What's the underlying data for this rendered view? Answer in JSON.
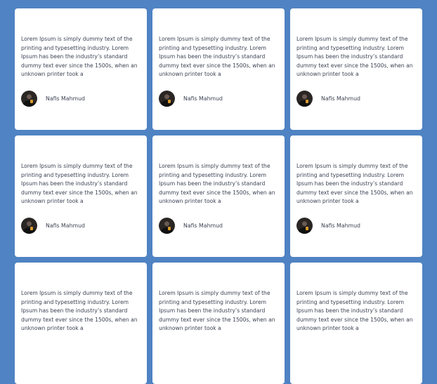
{
  "testimonials": [
    {
      "text": "Lorem Ipsum is simply dummy text of the printing and typesetting industry. Lorem Ipsum has been the industry’s standard dummy text ever since the 1500s, when an unknown printer took a",
      "author": "Nafis Mahmud"
    },
    {
      "text": "Lorem Ipsum is simply dummy text of the printing and typesetting industry. Lorem Ipsum has been the industry’s standard dummy text ever since the 1500s, when an unknown printer took a",
      "author": "Nafis Mahmud"
    },
    {
      "text": "Lorem Ipsum is simply dummy text of the printing and typesetting industry. Lorem Ipsum has been the industry’s standard dummy text ever since the 1500s, when an unknown printer took a",
      "author": "Nafis Mahmud"
    },
    {
      "text": "Lorem Ipsum is simply dummy text of the printing and typesetting industry. Lorem Ipsum has been the industry’s standard dummy text ever since the 1500s, when an unknown printer took a",
      "author": "Nafis Mahmud"
    },
    {
      "text": "Lorem Ipsum is simply dummy text of the printing and typesetting industry. Lorem Ipsum has been the industry’s standard dummy text ever since the 1500s, when an unknown printer took a",
      "author": "Nafis Mahmud"
    },
    {
      "text": "Lorem Ipsum is simply dummy text of the printing and typesetting industry. Lorem Ipsum has been the industry’s standard dummy text ever since the 1500s, when an unknown printer took a",
      "author": "Nafis Mahmud"
    },
    {
      "text": "Lorem Ipsum is simply dummy text of the printing and typesetting industry. Lorem Ipsum has been the industry’s standard dummy text ever since the 1500s, when an unknown printer took a",
      "author": ""
    },
    {
      "text": "Lorem Ipsum is simply dummy text of the printing and typesetting industry. Lorem Ipsum has been the industry’s standard dummy text ever since the 1500s, when an unknown printer took a",
      "author": ""
    },
    {
      "text": "Lorem Ipsum is simply dummy text of the printing and typesetting industry. Lorem Ipsum has been the industry’s standard dummy text ever since the 1500s, when an unknown printer took a",
      "author": ""
    }
  ],
  "colors": {
    "background": "#4f83c3",
    "card": "#ffffff",
    "text": "#3b4252"
  },
  "icons": {
    "avatar": "author-avatar"
  }
}
